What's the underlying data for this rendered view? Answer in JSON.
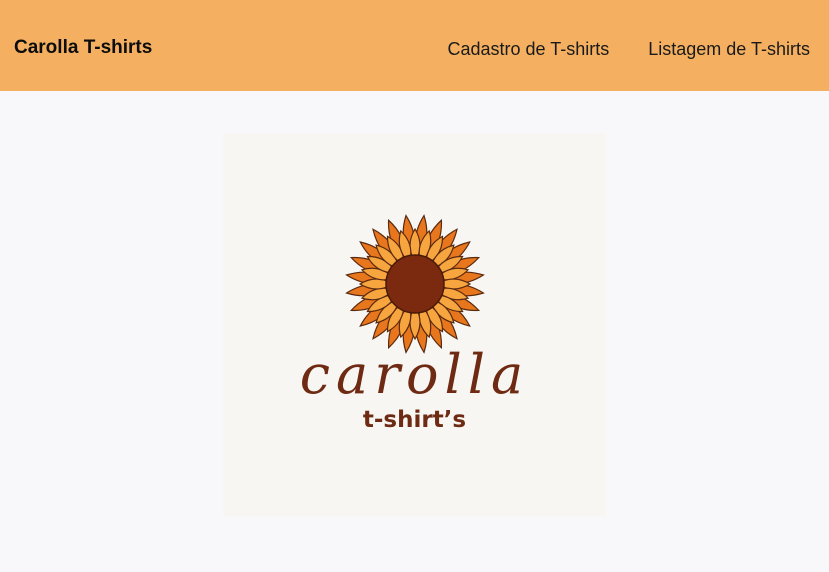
{
  "header": {
    "brand": "Carolla T-shirts",
    "nav": [
      {
        "label": "Cadastro de T-shirts"
      },
      {
        "label": "Listagem de T-shirts"
      }
    ],
    "background_color": "#f4b060"
  },
  "main": {
    "logo": {
      "icon": "sunflower-icon",
      "script_text": "carolla",
      "sub_text": "t-shirt’s",
      "petal_color": "#f39a2e",
      "center_color": "#7b2a10",
      "text_color": "#6e2a12"
    }
  }
}
